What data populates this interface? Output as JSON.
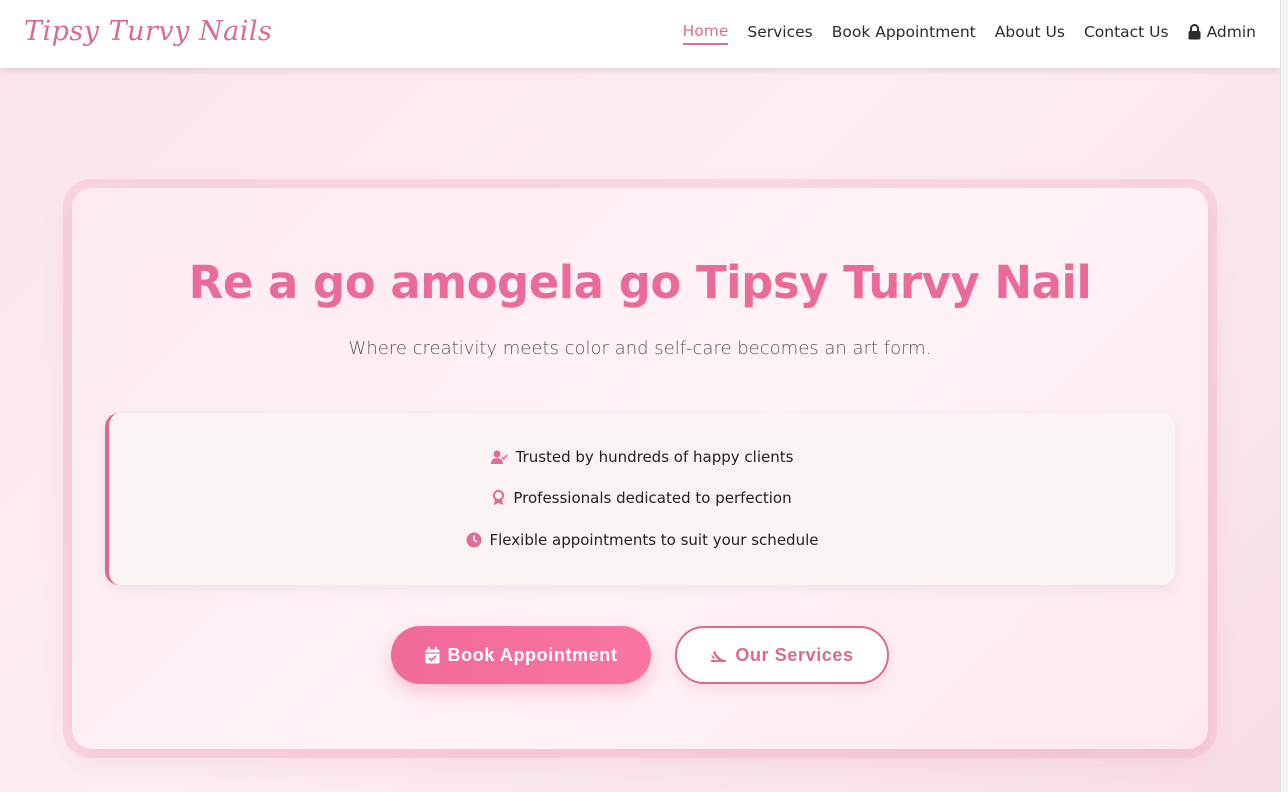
{
  "header": {
    "brand": "Tipsy Turvy Nails",
    "nav": [
      {
        "label": "Home",
        "active": true
      },
      {
        "label": "Services"
      },
      {
        "label": "Book Appointment"
      },
      {
        "label": "About Us"
      },
      {
        "label": "Contact Us"
      },
      {
        "label": "Admin",
        "icon": "lock-icon"
      }
    ]
  },
  "hero": {
    "title": "Re a go amogela go Tipsy Turvy Nail",
    "subtitle": "Where creativity meets color and self-care becomes an art form.",
    "features": [
      {
        "icon": "user-check-icon",
        "text": "Trusted by hundreds of happy clients"
      },
      {
        "icon": "award-icon",
        "text": "Professionals dedicated to perfection"
      },
      {
        "icon": "clock-icon",
        "text": "Flexible appointments to suit your schedule"
      }
    ],
    "buttons": {
      "book": {
        "label": "Book Appointment",
        "icon": "calendar-check-icon"
      },
      "services": {
        "label": "Our Services",
        "icon": "nail-polish-icon"
      }
    }
  },
  "colors": {
    "accent": "#e06a98",
    "button_gradient_start": "#ef6a98",
    "button_gradient_end": "#f975a4",
    "feature_box_bg": "#f9f4f1",
    "text_dark": "#2c2c2c"
  }
}
